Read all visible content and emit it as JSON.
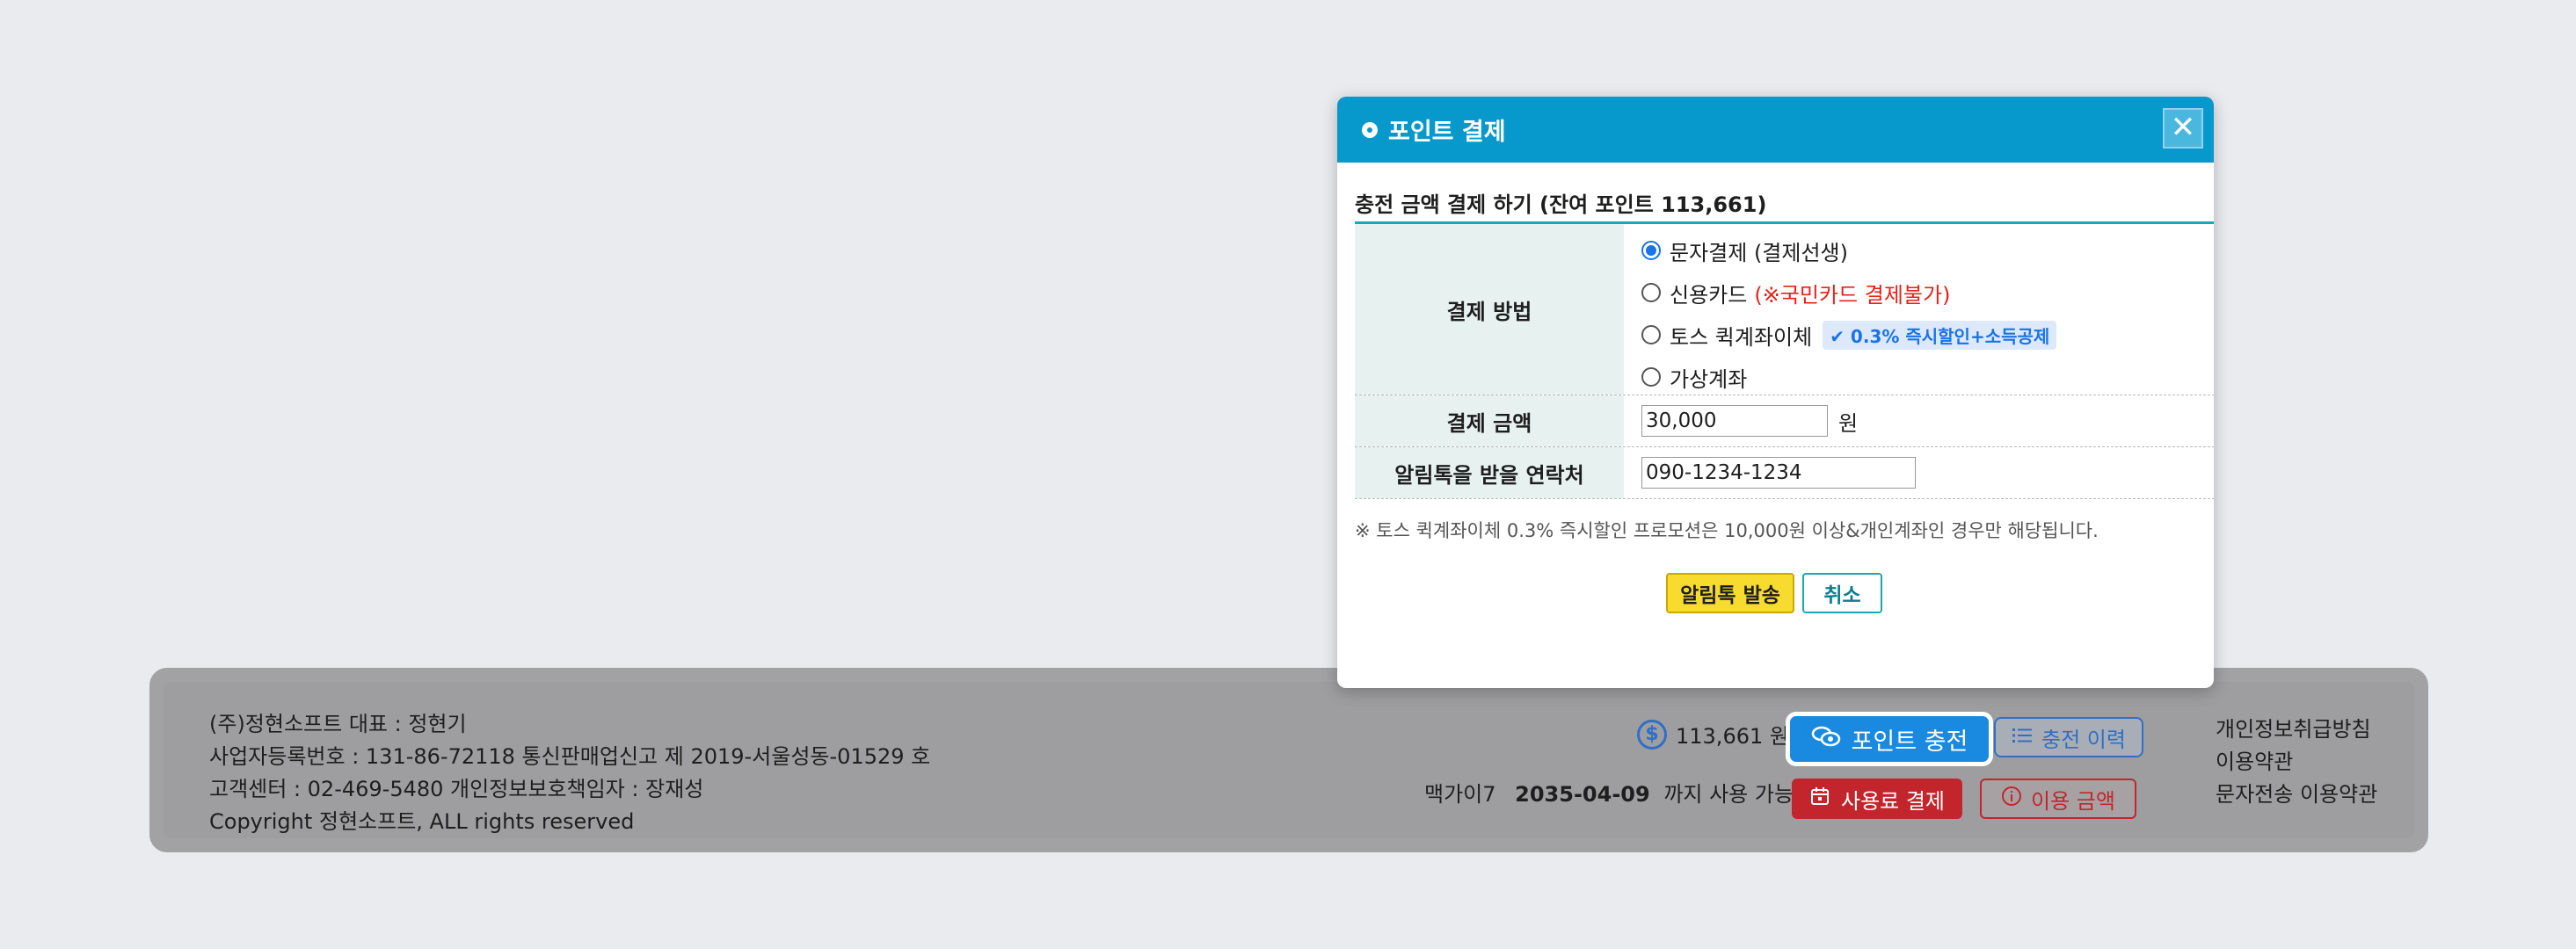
{
  "modal": {
    "title": "포인트 결제",
    "close_symbol": "✕",
    "section_title": "충전 금액 결제 하기 (잔여 포인트 113,661)",
    "method_label": "결제 방법",
    "methods": [
      {
        "label": "문자결제 (결제선생)",
        "selected": true
      },
      {
        "label": "신용카드",
        "note": "(※국민카드 결제불가)",
        "selected": false
      },
      {
        "label": "토스 퀵계좌이체",
        "badge": "✔ 0.3% 즉시할인+소득공제",
        "selected": false
      },
      {
        "label": "가상계좌",
        "selected": false
      }
    ],
    "amount_label": "결제 금액",
    "amount_value": "30,000",
    "amount_unit": "원",
    "contact_label": "알림톡을 받을 연락처",
    "contact_value": "090-1234-1234",
    "note": "※ 토스 퀵계좌이체 0.3% 즉시할인 프로모션은 10,000원 이상&개인계좌인 경우만 해당됩니다.",
    "send_button": "알림톡 발송",
    "cancel_button": "취소"
  },
  "footer": {
    "company_lines": [
      "(주)정현소프트 대표 : 정현기",
      "사업자등록번호 : 131-86-72118 통신판매업신고 제 2019-서울성동-01529 호",
      "고객센터 : 02-469-5480 개인정보보호책임자 : 장재성",
      "Copyright 정현소프트, ALL rights reserved"
    ],
    "point_balance": "113,661 원",
    "coin_symbol": "$",
    "charge_button": "포인트 충전",
    "history_button": "충전 이력",
    "account_name": "맥가이7",
    "expiry_date": "2035-04-09",
    "expiry_suffix": "까지 사용 가능",
    "pay_button": "사용료 결제",
    "usage_button": "이용 금액",
    "links": [
      "개인정보취급방침",
      "이용약관",
      "문자전송 이용약관"
    ]
  },
  "colors": {
    "modal_header": "#0799cc",
    "charge_button": "#1a8ae0",
    "pay_button": "#c2262c",
    "send_button": "#f7dc2f",
    "table_accent": "#19a7b7",
    "warning_text": "#e2231a"
  },
  "icons": {
    "coin": "dollar-coin-icon",
    "charge": "coins-icon",
    "history": "list-icon",
    "pay": "calendar-icon",
    "usage": "info-circle-icon",
    "close": "close-icon"
  }
}
